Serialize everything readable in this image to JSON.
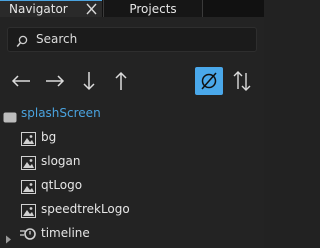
{
  "tabs": {
    "navigator_label": "Navigator",
    "projects_label": "Projects"
  },
  "search": {
    "placeholder": "Search"
  },
  "toolbar": {
    "accent_color": "#4aa8ea",
    "buttons": [
      {
        "icon": "arrow-left-icon"
      },
      {
        "icon": "arrow-right-icon"
      },
      {
        "icon": "arrow-down-icon"
      },
      {
        "icon": "arrow-up-icon"
      },
      {
        "icon": "filter-hidden-icon",
        "active": true
      },
      {
        "icon": "sort-icon"
      }
    ]
  },
  "tree": {
    "root": {
      "label": "splashScreen",
      "icon": "component-icon",
      "color": "#4aa3df"
    },
    "children": [
      {
        "label": "bg",
        "icon": "image-icon"
      },
      {
        "label": "slogan",
        "icon": "image-icon"
      },
      {
        "label": "qtLogo",
        "icon": "image-icon"
      },
      {
        "label": "speedtrekLogo",
        "icon": "image-icon"
      },
      {
        "label": "timeline",
        "icon": "timeline-icon",
        "collapsed": true
      }
    ]
  }
}
